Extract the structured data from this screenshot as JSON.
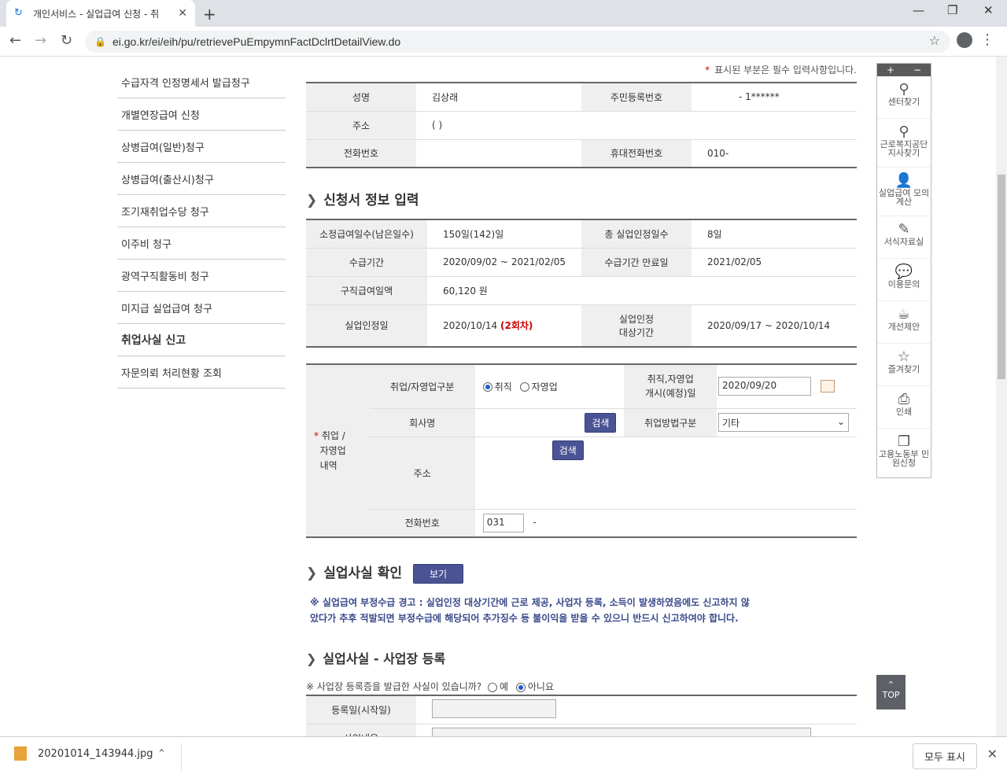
{
  "browser": {
    "tab_title": "개인서비스 - 실업급여 신청 - 취",
    "url": "ei.go.kr/ei/eih/pu/retrievePuEmpymnFactDclrtDetailView.do"
  },
  "sidebar": {
    "items": [
      {
        "label": "수급자격 인정명세서 발급청구"
      },
      {
        "label": "개별연장급여 신청"
      },
      {
        "label": "상병급여(일반)청구"
      },
      {
        "label": "상병급여(출산시)청구"
      },
      {
        "label": "조기재취업수당 청구"
      },
      {
        "label": "이주비 청구"
      },
      {
        "label": "광역구직활동비 청구"
      },
      {
        "label": "미지급 실업급여 청구"
      },
      {
        "label": "취업사실 신고"
      },
      {
        "label": "자문의뢰 처리현황 조회"
      }
    ]
  },
  "required_note": "표시된 부분은 필수 입력사항입니다.",
  "personal": {
    "name_label": "성명",
    "name": "김상래",
    "rrn_label": "주민등록번호",
    "rrn": "- 1******",
    "addr_label": "주소",
    "addr": "(        )",
    "phone_label": "전화번호",
    "phone": "",
    "mobile_label": "휴대전화번호",
    "mobile": "010-"
  },
  "application": {
    "title": "신청서 정보 입력",
    "days_label": "소정급여일수(남은일수)",
    "days": "150일(142)일",
    "total_label": "총 실업인정일수",
    "total": "8일",
    "period_label": "수급기간",
    "period": "2020/09/02 ~ 2021/02/05",
    "end_label": "수급기간 만료일",
    "end": "2021/02/05",
    "daily_label": "구직급여일액",
    "daily": "60,120 원",
    "recog_label": "실업인정일",
    "recog": "2020/10/14",
    "recog_round": "(2회차)",
    "target_label1": "실업인정",
    "target_label2": "대상기간",
    "target": "2020/09/17   ~   2020/10/14"
  },
  "employment": {
    "group_label1": "취업 /",
    "group_label2": "자영업",
    "group_label3": "내역",
    "type_label": "취업/자영업구분",
    "type_opt1": "취직",
    "type_opt2": "자영업",
    "start_label1": "취직,자영업",
    "start_label2": "개시(예정)일",
    "start_date": "2020/09/20",
    "company_label": "회사명",
    "search": "검색",
    "method_label": "취업방법구분",
    "method": "기타",
    "addr_label": "주소",
    "phone_label": "전화번호",
    "phone_prefix": "031",
    "phone_dash": "-"
  },
  "confirm": {
    "title": "실업사실 확인",
    "view_btn": "보기",
    "warn1": "※ 실업급여 부정수급 경고 : 실업인정 대상기간에 근로 제공, 사업자 등록, 소득이 발생하였음에도 신고하지 않",
    "warn2": "았다가 추후 적발되면 부정수급에 해당되어 추가징수 등 불이익을 받을 수 있으니 반드시 신고하여야 합니다."
  },
  "business": {
    "title": "실업사실 - 사업장 등록",
    "question": "※ 사업장 등록증을 발급한 사실이 있습니까?",
    "yes": "예",
    "no": "아니요",
    "reg_label": "등록일(시작일)",
    "next_label": "사업내용"
  },
  "floatbar": {
    "plus": "+",
    "minus": "−",
    "items": [
      {
        "label": "센터찾기",
        "icon": "map-pin-icon"
      },
      {
        "label": "근로복지공단 지사찾기",
        "icon": "map-pin-icon"
      },
      {
        "label": "실업급여 모의계산",
        "icon": "person-icon"
      },
      {
        "label": "서식자료실",
        "icon": "edit-icon"
      },
      {
        "label": "이용문의",
        "icon": "chat-icon"
      },
      {
        "label": "개선제안",
        "icon": "cup-icon"
      },
      {
        "label": "즐겨찾기",
        "icon": "star-icon"
      },
      {
        "label": "인쇄",
        "icon": "printer-icon"
      },
      {
        "label": "고용노동부 민원신청",
        "icon": "documents-icon"
      }
    ],
    "top": "TOP"
  },
  "downloads": {
    "file": "20201014_143944.jpg",
    "show_all": "모두 표시"
  }
}
